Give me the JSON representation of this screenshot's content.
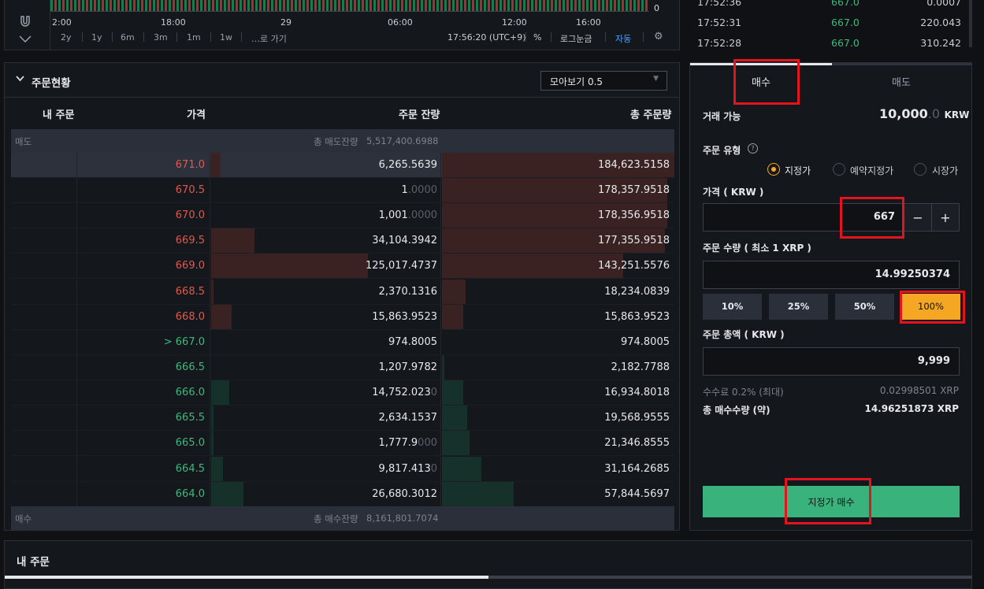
{
  "chart": {
    "y_zero": "0",
    "x_ticks": [
      "2:00",
      "18:00",
      "29",
      "06:00",
      "12:00",
      "16:00"
    ],
    "periods": [
      "2y",
      "1y",
      "6m",
      "3m",
      "1m",
      "1w",
      "…로 가기"
    ],
    "clock": "17:56:20 (UTC+9)",
    "pct_label": "%",
    "log_label": "로그눈금",
    "auto_label": "자동"
  },
  "trades": [
    {
      "time": "17:52:36",
      "price": "667.0",
      "volume": "0.0007"
    },
    {
      "time": "17:52:31",
      "price": "667.0",
      "volume": "220.043"
    },
    {
      "time": "17:52:28",
      "price": "667.0",
      "volume": "310.242"
    }
  ],
  "orderbook": {
    "title": "주문현황",
    "grouping": "모아보기 0.5",
    "columns": {
      "mine": "내 주문",
      "price": "가격",
      "qty": "주문 잔량",
      "total": "총 주문량"
    },
    "ask_section": {
      "label": "매도",
      "total_label": "총 매도잔량",
      "total": "5,517,400.6988"
    },
    "bid_section": {
      "label": "매수",
      "total_label": "총 매수잔량",
      "total": "8,161,801.7074"
    },
    "asks": [
      {
        "price": "671.0",
        "qty": "6,265.5639",
        "qty_frac": "",
        "total": "184,623.5158",
        "qty_ratio": 0.04,
        "total_ratio": 1.0
      },
      {
        "price": "670.5",
        "qty": "1",
        "qty_frac": ".0000",
        "total": "178,357.9518",
        "qty_ratio": 0.0,
        "total_ratio": 0.97
      },
      {
        "price": "670.0",
        "qty": "1,001",
        "qty_frac": ".0000",
        "total": "178,356.9518",
        "qty_ratio": 0.0,
        "total_ratio": 0.97
      },
      {
        "price": "669.5",
        "qty": "34,104.3942",
        "qty_frac": "",
        "total": "177,355.9518",
        "qty_ratio": 0.19,
        "total_ratio": 0.96
      },
      {
        "price": "669.0",
        "qty": "125,017.4737",
        "qty_frac": "",
        "total": "143,251.5576",
        "qty_ratio": 0.68,
        "total_ratio": 0.78
      },
      {
        "price": "668.5",
        "qty": "2,370.1316",
        "qty_frac": "",
        "total": "18,234.0839",
        "qty_ratio": 0.01,
        "total_ratio": 0.1
      },
      {
        "price": "668.0",
        "qty": "15,863.9523",
        "qty_frac": "",
        "total": "15,863.9523",
        "qty_ratio": 0.09,
        "total_ratio": 0.09
      }
    ],
    "bids": [
      {
        "price": "> 667.0",
        "qty": "974.8005",
        "qty_frac": "",
        "total": "974.8005",
        "qty_ratio": 0.0,
        "total_ratio": 0.0
      },
      {
        "price": "666.5",
        "qty": "1,207.9782",
        "qty_frac": "",
        "total": "2,182.7788",
        "qty_ratio": 0.0,
        "total_ratio": 0.01
      },
      {
        "price": "666.0",
        "qty": "14,752.023",
        "qty_frac": "0",
        "total": "16,934.8018",
        "qty_ratio": 0.08,
        "total_ratio": 0.09
      },
      {
        "price": "665.5",
        "qty": "2,634.1537",
        "qty_frac": "",
        "total": "19,568.9555",
        "qty_ratio": 0.01,
        "total_ratio": 0.11
      },
      {
        "price": "665.0",
        "qty": "1,777.9",
        "qty_frac": "000",
        "total": "21,346.8555",
        "qty_ratio": 0.01,
        "total_ratio": 0.12
      },
      {
        "price": "664.5",
        "qty": "9,817.413",
        "qty_frac": "0",
        "total": "31,164.2685",
        "qty_ratio": 0.05,
        "total_ratio": 0.17
      },
      {
        "price": "664.0",
        "qty": "26,680.3012",
        "qty_frac": "",
        "total": "57,844.5697",
        "qty_ratio": 0.14,
        "total_ratio": 0.31
      }
    ]
  },
  "order_form": {
    "tab_buy": "매수",
    "tab_sell": "매도",
    "available_label": "거래 가능",
    "available_value": "10,000",
    "available_frac": ".0",
    "available_currency": "KRW",
    "order_type_label": "주문 유형",
    "help_icon": "?",
    "order_types": [
      "지정가",
      "예약지정가",
      "시장가"
    ],
    "price_label": "가격 ( KRW )",
    "price_value": "667",
    "minus": "−",
    "plus": "+",
    "qty_label": "주문 수량 ( 최소 1 XRP )",
    "qty_value": "14.99250374",
    "percents": [
      "10%",
      "25%",
      "50%",
      "100%"
    ],
    "total_label": "주문 총액 ( KRW )",
    "total_value": "9,999",
    "fee_label": "수수료 0.2% (최대)",
    "fee_value": "0.02998501 XRP",
    "buy_qty_label": "총 매수수량 (약)",
    "buy_qty_value": "14.96251873 XRP",
    "submit_label": "지정가 매수"
  },
  "my_orders": {
    "title": "내 주문"
  }
}
